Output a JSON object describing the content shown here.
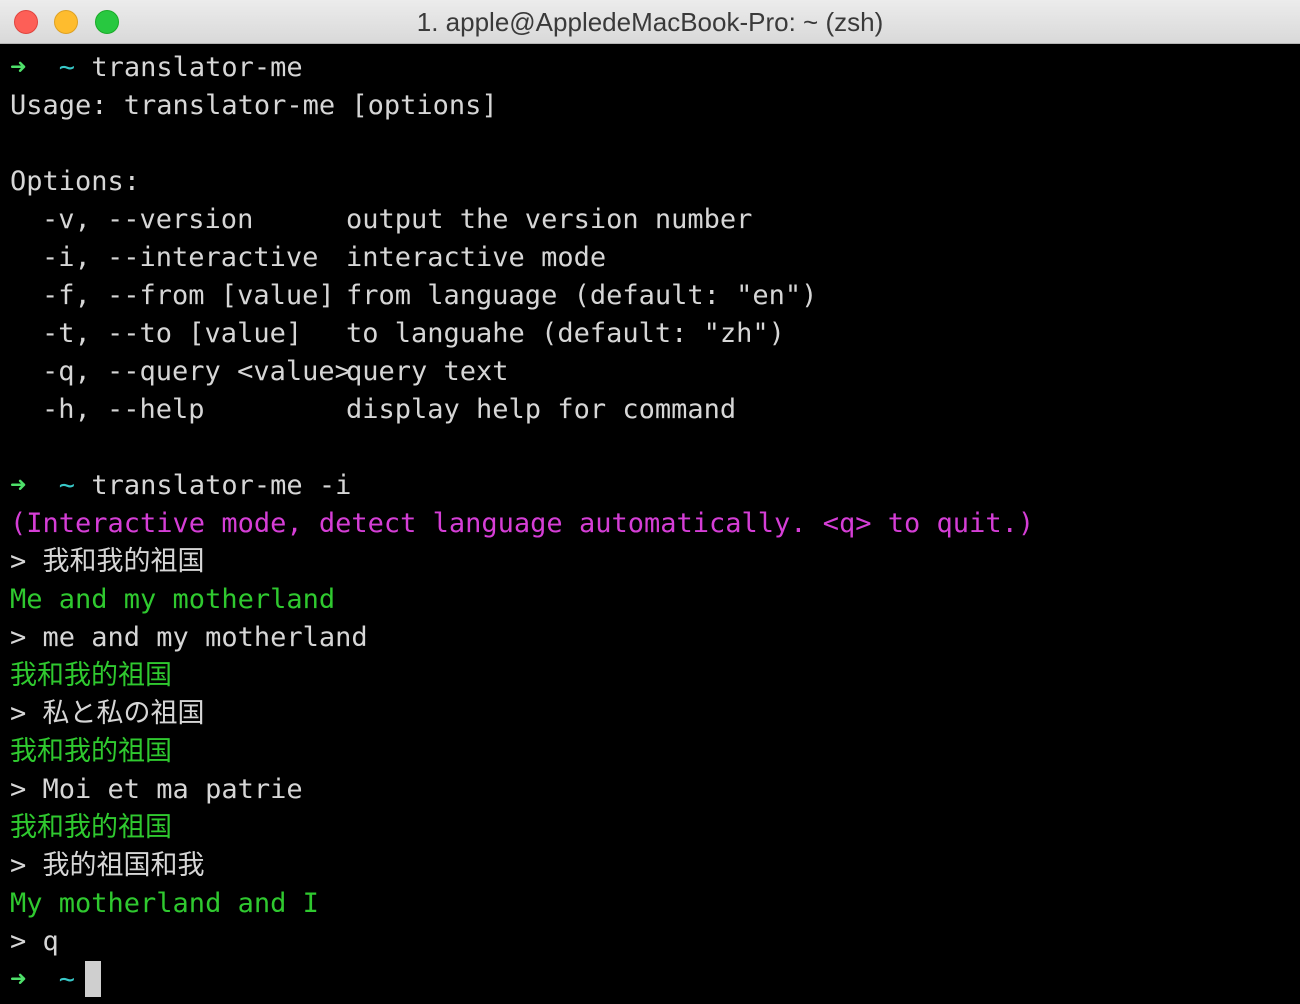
{
  "window": {
    "title": "1. apple@AppledeMacBook-Pro: ~ (zsh)"
  },
  "colors": {
    "prompt_arrow": "#4ee06a",
    "prompt_dir": "#38c8c8",
    "notice": "#d53ed6",
    "translation": "#2fc92f",
    "default_text": "#d6d6d6",
    "background": "#000000"
  },
  "prompt": {
    "arrow": "➜",
    "dir": "~"
  },
  "session": {
    "cmd1": "translator-me",
    "usage": "Usage: translator-me [options]",
    "options_header": "Options:",
    "options": [
      {
        "flag": "-v, --version",
        "desc": "output the version number"
      },
      {
        "flag": "-i, --interactive",
        "desc": "interactive mode"
      },
      {
        "flag": "-f, --from [value]",
        "desc": "from language (default: \"en\")"
      },
      {
        "flag": "-t, --to [value]",
        "desc": "to languahe (default: \"zh\")"
      },
      {
        "flag": "-q, --query <value>",
        "desc": "query text"
      },
      {
        "flag": "-h, --help",
        "desc": "display help for command"
      }
    ],
    "cmd2": "translator-me -i",
    "interactive_notice": "(Interactive mode, detect language automatically. <q> to quit.)",
    "exchanges": [
      {
        "input": "> 我和我的祖国",
        "output": "Me and my motherland"
      },
      {
        "input": "> me and my motherland",
        "output": "我和我的祖国"
      },
      {
        "input": "> 私と私の祖国",
        "output": "我和我的祖国"
      },
      {
        "input": "> Moi et ma patrie",
        "output": "我和我的祖国"
      },
      {
        "input": "> 我的祖国和我",
        "output": "My motherland and I"
      }
    ],
    "quit_input": "> q"
  }
}
